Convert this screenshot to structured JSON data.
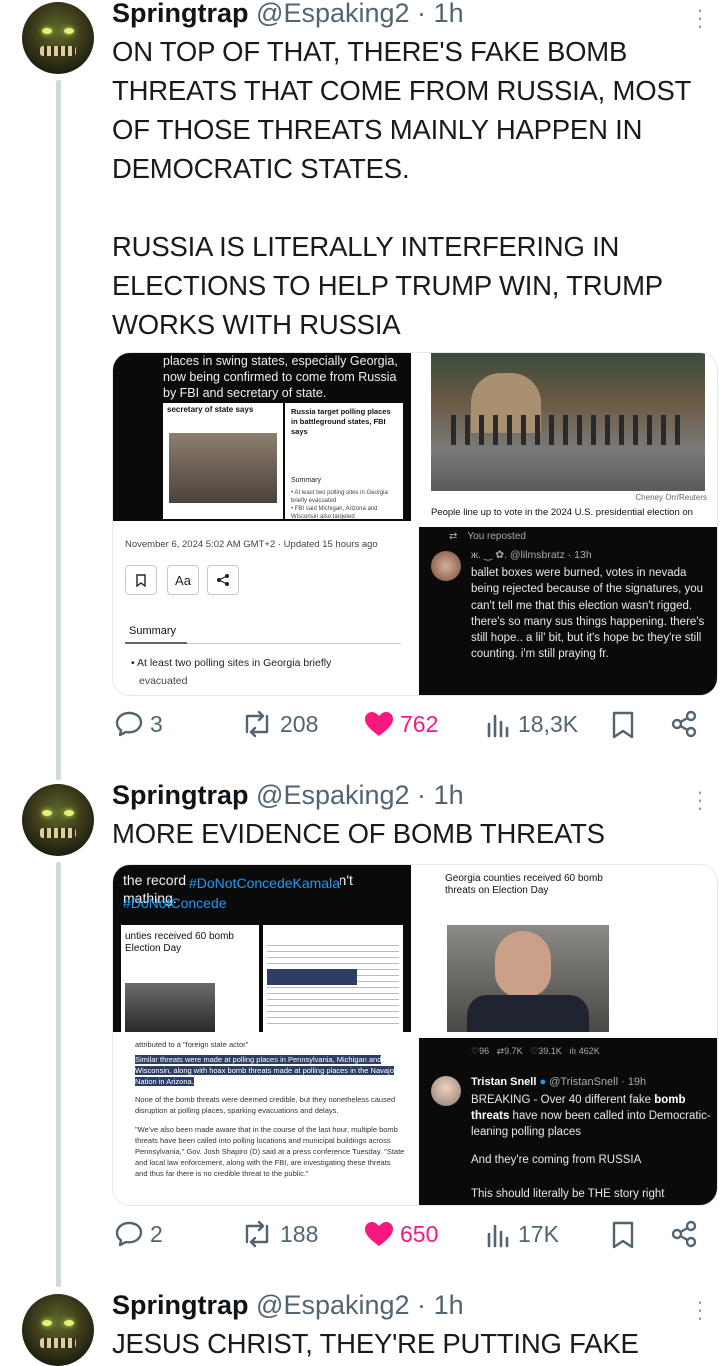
{
  "posts": [
    {
      "author": "Springtrap",
      "handle": "@Espaking2",
      "time_sep": "·",
      "time": "1h",
      "text": "ON TOP OF THAT, THERE'S FAKE BOMB THREATS THAT COME FROM RUSSIA, MOST OF THOSE THREATS MAINLY HAPPEN IN DEMOCRATIC STATES.\n\nRUSSIA IS LITERALLY INTERFERING IN ELECTIONS TO HELP TRUMP WIN, TRUMP WORKS WITH RUSSIA",
      "media": {
        "img1": {
          "caption": "places in swing states, especially Georgia, now being confirmed to come from Russia by FBI and secretary of state.",
          "inner_title_left": "secretary of state says",
          "inner_title_right": "Russia target polling places in battleground states, FBI says",
          "inner_summary": "Summary",
          "inner_bullets": "• At least two polling sites in Georgia briefly evacuated\n• FBI said Michigan, Arizona and Wisconsin also targeted"
        },
        "img2": {
          "credit": "Cheney Orr/Reuters",
          "caption": "People line up to vote in the 2024 U.S. presidential election on"
        },
        "img3": {
          "timestamp": "November 6, 2024 5:02 AM GMT+2 · Updated 15 hours ago",
          "font_button": "Aa",
          "summary_label": "Summary",
          "bullet": "• At least two polling sites in Georgia briefly",
          "bullet_cont": "evacuated"
        },
        "img4": {
          "reposted": "You reposted",
          "quoted_handle": "ж. ‿ ✿. @lilmsbratz · 13h",
          "quoted_text": "ballet boxes were burned, votes in nevada being rejected because of the signatures, you can't tell me that this election wasn't rigged. there's so many sus things happening. there's still hope.. a lil' bit, but it's hope bc they're still counting. i'm still praying fr."
        }
      },
      "stats": {
        "replies": "3",
        "reposts": "208",
        "likes": "762",
        "views": "18,3K"
      }
    },
    {
      "author": "Springtrap",
      "handle": "@Espaking2",
      "time_sep": "·",
      "time": "1h",
      "text": "MORE EVIDENCE OF BOMB THREATS",
      "media": {
        "img1": {
          "top_text": "the record early voting, the math ain't mathing.",
          "hashtag1": "#DoNotConcedeKamala",
          "hashtag2": "#DoNotConcede",
          "inner_title": "unties received 60 bomb Election Day"
        },
        "img2": {
          "headline": "Georgia counties received 60 bomb threats on Election Day"
        },
        "img3": {
          "attributed": "attributed to a \"foreign state actor\"",
          "highlight": "Similar threats were made at polling places in Pennsylvania, Michigan and Wisconsin, along with hoax bomb threats made at polling places in the Navajo Nation in Arizona.",
          "para1": "None of the bomb threats were deemed credible, but they nonetheless caused disruption at polling places, sparking evacuations and delays.",
          "para2": "\"We've also been made aware that in the course of the last hour, multiple bomb threats have been called into polling locations and municipal buildings across Pennsylvania,\" Gov. Josh Shapiro (D) said at a press conference Tuesday. \"State and local law enforcement, along with the FBI, are investigating these threats and thus far there is no credible threat to the public.\""
        },
        "img4": {
          "stats_row": "♡96   ⇄9.7K   ♡39.1K   ılı 462K",
          "author": "Tristan Snell",
          "handle": "@TristanSnell · 19h",
          "text_a": "BREAKING - Over 40 different fake ",
          "text_bold": "bomb threats",
          "text_b": " have now been called into Democratic-leaning polling places",
          "text_c": "And they're coming from RUSSIA",
          "text_d": "This should literally be THE story right"
        }
      },
      "stats": {
        "replies": "2",
        "reposts": "188",
        "likes": "650",
        "views": "17K"
      }
    },
    {
      "author": "Springtrap",
      "handle": "@Espaking2",
      "time_sep": "·",
      "time": "1h",
      "text": "JESUS CHRIST, THEY'RE PUTTING FAKE"
    }
  ],
  "colors": {
    "like": "#f91880",
    "muted": "#536471",
    "thread_line": "#cfd9de"
  },
  "icons": [
    "more-icon",
    "reply-icon",
    "repost-icon",
    "like-icon",
    "views-icon",
    "bookmark-icon",
    "share-icon"
  ]
}
